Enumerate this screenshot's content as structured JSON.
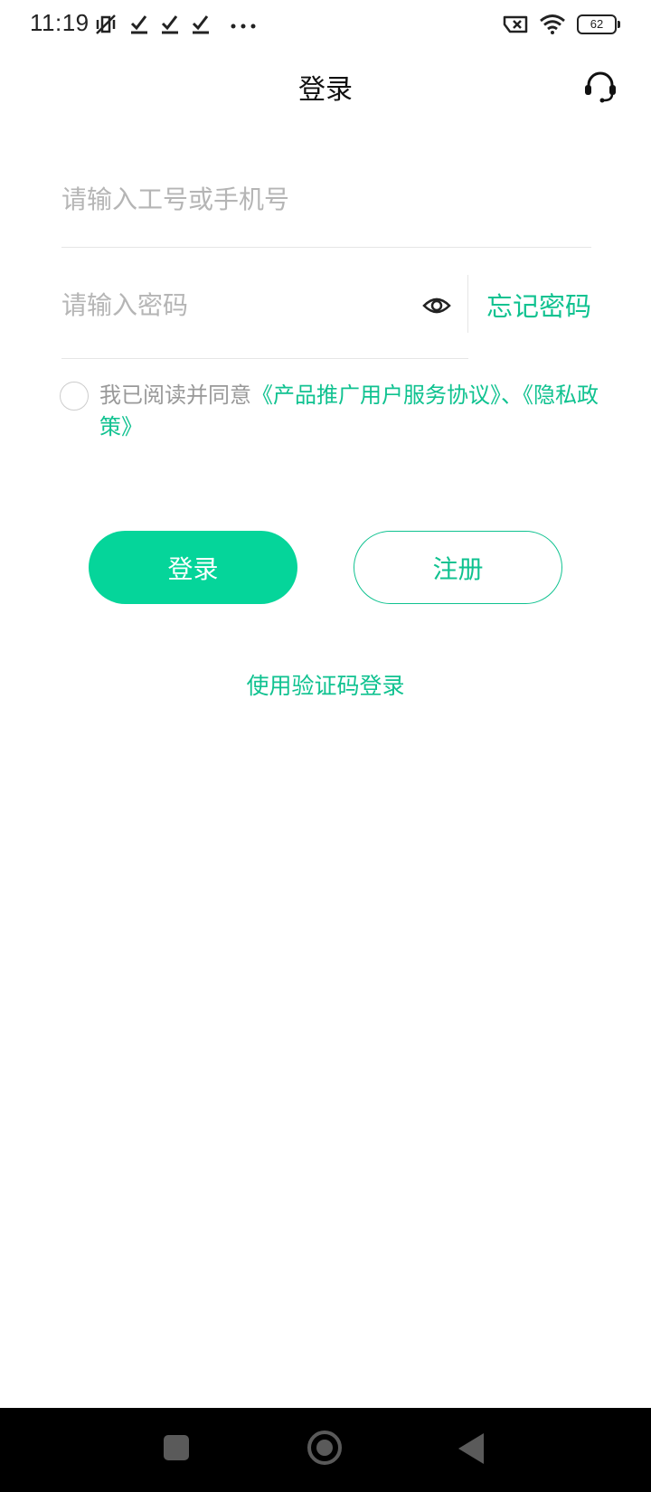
{
  "status_bar": {
    "time": "11:19",
    "left_icons": [
      "mute-vibrate-icon",
      "check-icon",
      "check-icon",
      "check-icon",
      "more-dots-icon"
    ],
    "right_icons": [
      "no-sim-icon",
      "wifi-icon",
      "battery-icon"
    ],
    "battery_level": "62"
  },
  "header": {
    "title": "登录",
    "support_icon": "headset-icon"
  },
  "form": {
    "account_placeholder": "请输入工号或手机号",
    "account_value": "",
    "password_placeholder": "请输入密码",
    "password_value": "",
    "eye_icon": "eye-icon",
    "forgot_password": "忘记密码"
  },
  "agreement": {
    "checked": false,
    "prefix": "我已阅读并同意",
    "link1": "《产品推广用户服务协议》",
    "separator": "、",
    "link2": "《隐私政策》"
  },
  "buttons": {
    "login": "登录",
    "register": "注册"
  },
  "sms_login": "使用验证码登录",
  "colors": {
    "accent": "#05d59a",
    "link": "#10c290",
    "placeholder": "#b5b5b5",
    "nav_bar": "#000000"
  },
  "nav_bar": {
    "icons": [
      "recent-apps-icon",
      "home-icon",
      "back-icon"
    ]
  }
}
